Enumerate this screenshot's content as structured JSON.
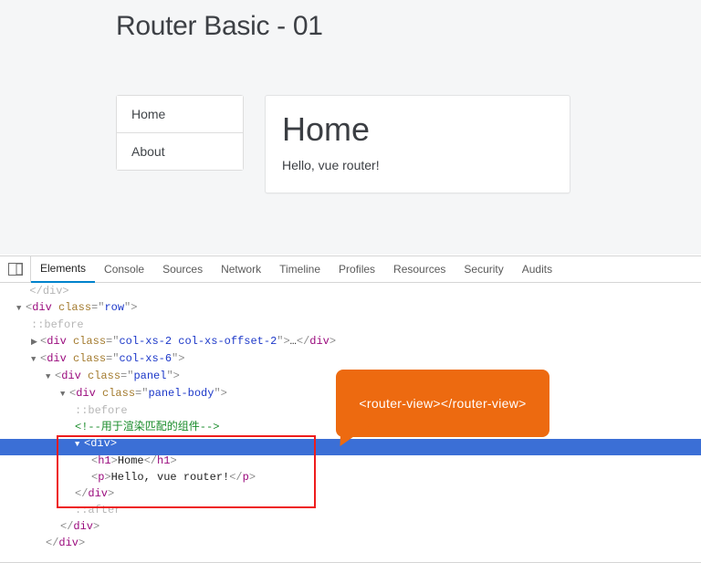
{
  "app": {
    "title": "Router Basic - 01",
    "nav": [
      {
        "label": "Home"
      },
      {
        "label": "About"
      }
    ],
    "panel": {
      "heading": "Home",
      "text": "Hello, vue router!"
    }
  },
  "devtools": {
    "tabs": [
      {
        "label": "Elements",
        "active": true
      },
      {
        "label": "Console"
      },
      {
        "label": "Sources"
      },
      {
        "label": "Network"
      },
      {
        "label": "Timeline"
      },
      {
        "label": "Profiles"
      },
      {
        "label": "Resources"
      },
      {
        "label": "Security"
      },
      {
        "label": "Audits"
      }
    ],
    "dom": {
      "l0_close": "</div>",
      "row_open": {
        "tag": "div",
        "class": "row"
      },
      "before": "::before",
      "col1": {
        "tag": "div",
        "class": "col-xs-2 col-xs-offset-2",
        "ell": "…"
      },
      "col2": {
        "tag": "div",
        "class": "col-xs-6"
      },
      "panel": {
        "tag": "div",
        "class": "panel"
      },
      "panelbody": {
        "tag": "div",
        "class": "panel-body"
      },
      "before2": "::before",
      "comment": "<!--用于渲染匹配的组件-->",
      "innerdiv": {
        "tag": "div"
      },
      "h1": {
        "tag": "h1",
        "text": "Home"
      },
      "p": {
        "tag": "p",
        "text": "Hello, vue router!"
      },
      "close_div1": "</div>",
      "after": "::after",
      "close_div2": "</div>",
      "close_div3": "</div>"
    },
    "callout": "<router-view></router-view>"
  }
}
